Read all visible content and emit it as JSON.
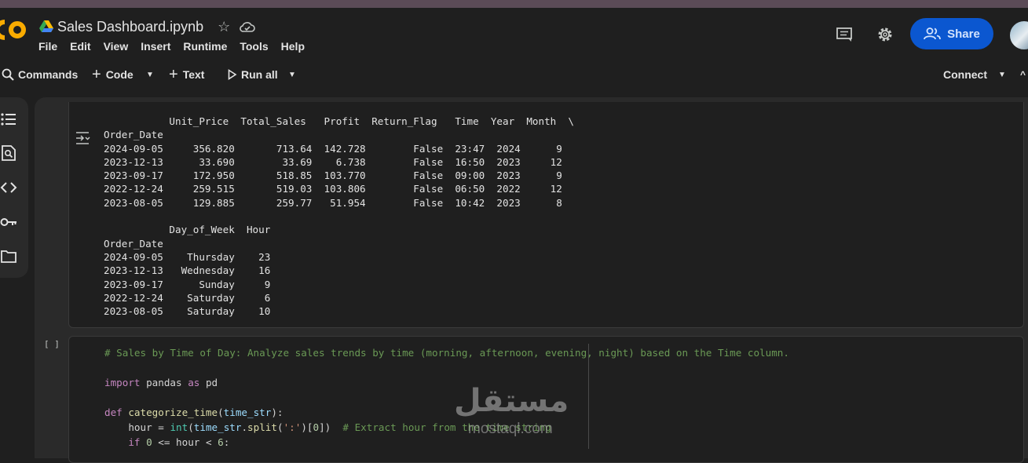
{
  "notebook": {
    "title": "Sales Dashboard.ipynb",
    "menu": [
      "File",
      "Edit",
      "View",
      "Insert",
      "Runtime",
      "Tools",
      "Help"
    ],
    "share_label": "Share"
  },
  "toolbar": {
    "commands": "Commands",
    "code": "Code",
    "text": "Text",
    "run_all": "Run all",
    "connect": "Connect"
  },
  "output": {
    "lines": [
      "           Unit_Price  Total_Sales   Profit  Return_Flag   Time  Year  Month  \\",
      "Order_Date",
      "2024-09-05     356.820       713.64  142.728        False  23:47  2024      9",
      "2023-12-13      33.690        33.69    6.738        False  16:50  2023     12",
      "2023-09-17     172.950       518.85  103.770        False  09:00  2023      9",
      "2022-12-24     259.515       519.03  103.806        False  06:50  2022     12",
      "2023-08-05     129.885       259.77   51.954        False  10:42  2023      8",
      "",
      "           Day_of_Week  Hour",
      "Order_Date",
      "2024-09-05    Thursday    23",
      "2023-12-13   Wednesday    16",
      "2023-09-17      Sunday     9",
      "2022-12-24    Saturday     6",
      "2023-08-05    Saturday    10"
    ]
  },
  "code_cell": {
    "run_indicator": "[ ]",
    "comment": "# Sales by Time of Day: Analyze sales trends by time (morning, afternoon, evening, night) based on the Time column.",
    "import_kw": "import",
    "import_mod": "pandas",
    "as_kw": "as",
    "alias": "pd",
    "def_kw": "def",
    "fn_name": "categorize_time",
    "fn_param": "time_str",
    "hour_var": "hour",
    "int_fn": "int",
    "split_str": "':'",
    "extract_comment": "# Extract hour from the time string",
    "if_kw": "if",
    "zero": "0",
    "six": "6"
  },
  "watermark": {
    "arabic": "مستقل",
    "latin": "mostaql.com"
  },
  "colors": {
    "accent": "#0b57d0",
    "background": "#1f1f1f"
  }
}
